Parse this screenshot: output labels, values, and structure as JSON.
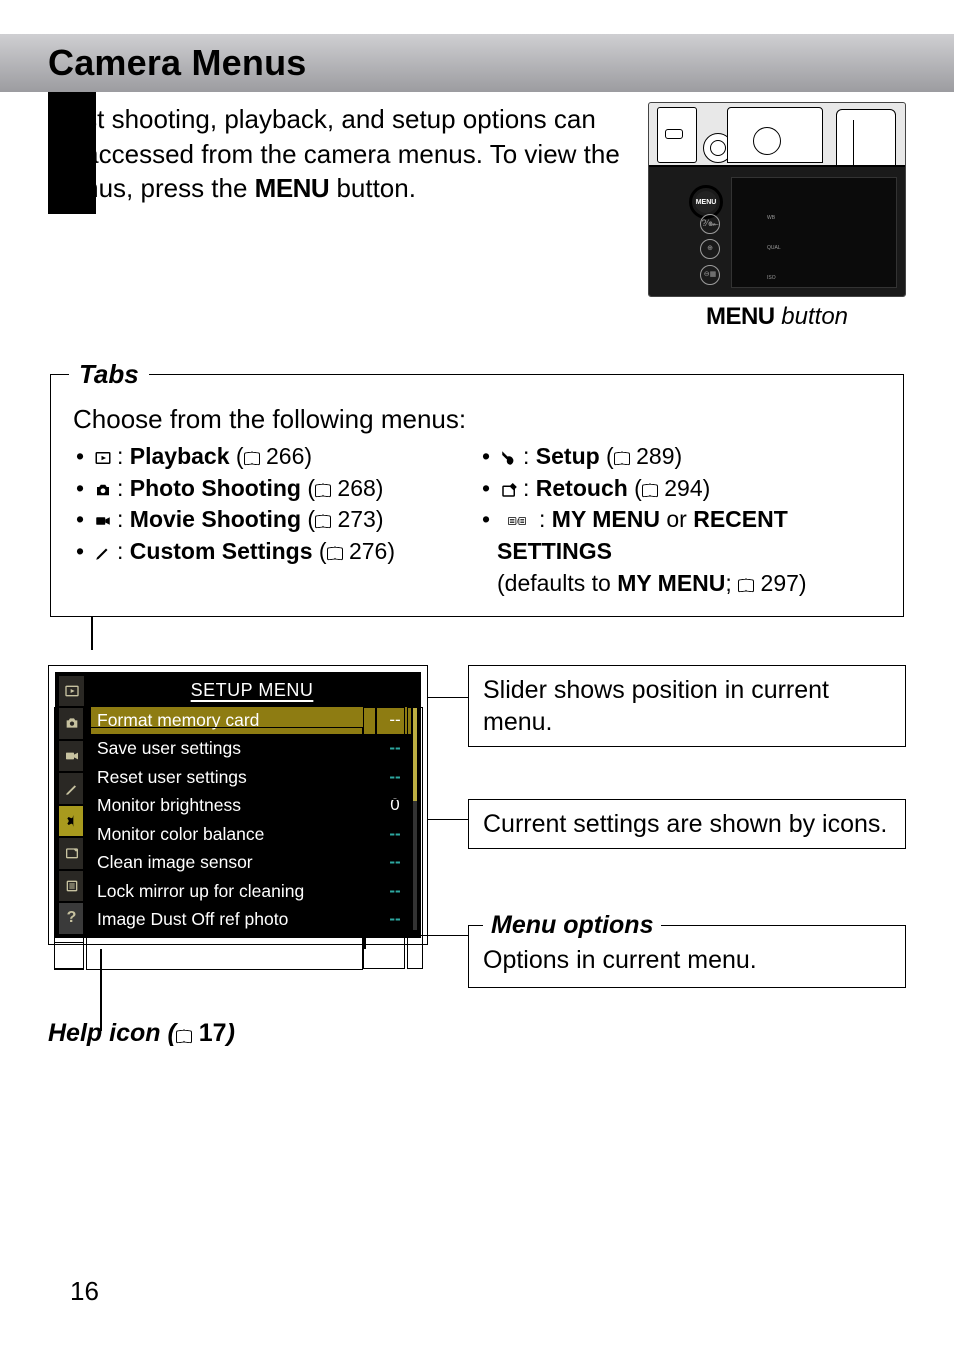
{
  "page_number": "16",
  "heading": "Camera Menus",
  "intro": {
    "text": "Most shooting, playback, and setup options can be accessed from the camera menus.  To view the menus, press the ",
    "menu_word": "MENU",
    "suffix": " button."
  },
  "camera_caption": {
    "menu_word": "MENU",
    "rest": " button"
  },
  "camera_buttons": {
    "menu": "MENU",
    "wb": "WB",
    "qual": "QUAL",
    "iso": "ISO"
  },
  "tabs": {
    "legend": "Tabs",
    "intro": "Choose from the following menus:",
    "left": [
      {
        "icon": "play",
        "name": "Playback",
        "page": "266"
      },
      {
        "icon": "camera",
        "name": "Photo Shooting",
        "page": "268"
      },
      {
        "icon": "movie",
        "name": "Movie Shooting",
        "page": "273"
      },
      {
        "icon": "pencil",
        "name": "Custom Settings",
        "page": "276"
      }
    ],
    "right": [
      {
        "icon": "wrench",
        "name": "Setup",
        "page": "289"
      },
      {
        "icon": "retouch",
        "name": "Retouch",
        "page": "294"
      },
      {
        "icon": "mymenu",
        "line1_a": "MY MENU",
        "line1_b": " or ",
        "line1_c": "RECENT SETTINGS",
        "line2_a": "(defaults to ",
        "line2_b": "MY MENU",
        "line2_c": "; ",
        "line2_page": "297",
        "line2_d": ")"
      }
    ]
  },
  "lcd": {
    "title": "SETUP MENU",
    "rows": [
      {
        "label": "Format memory card",
        "value": "--",
        "sel": true,
        "cls": ""
      },
      {
        "label": "Save user settings",
        "value": "--",
        "sel": false,
        "cls": ""
      },
      {
        "label": "Reset user settings",
        "value": "--",
        "sel": false,
        "cls": ""
      },
      {
        "label": "Monitor brightness",
        "value": "0",
        "sel": false,
        "cls": "white"
      },
      {
        "label": "Monitor color balance",
        "value": "--",
        "sel": false,
        "cls": ""
      },
      {
        "label": "Clean image sensor",
        "value": "--",
        "sel": false,
        "cls": ""
      },
      {
        "label": "Lock mirror up for cleaning",
        "value": "--",
        "sel": false,
        "cls": ""
      },
      {
        "label": "Image Dust Off ref photo",
        "value": "--",
        "sel": false,
        "cls": ""
      }
    ]
  },
  "annotations": {
    "slider": "Slider shows position in current menu.",
    "current": "Current settings are shown by icons.",
    "options_legend": "Menu options",
    "options_body": "Options in current menu.",
    "help_a": "Help icon (",
    "help_page": "17",
    "help_b": ")"
  }
}
